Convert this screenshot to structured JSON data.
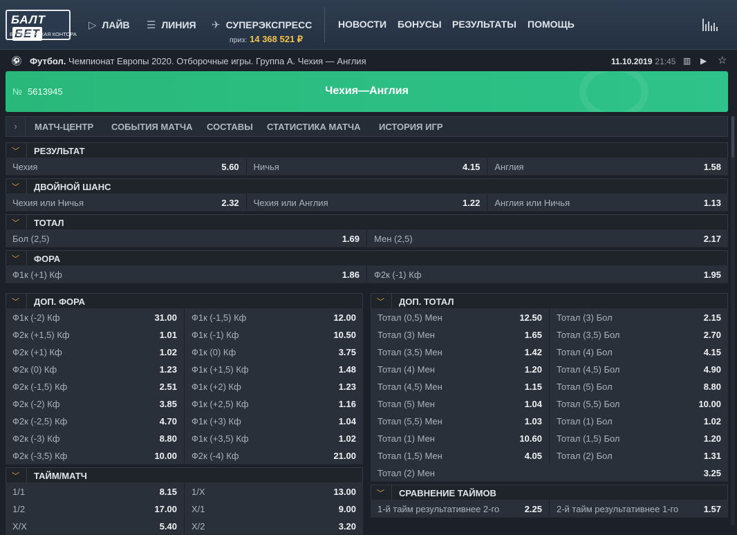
{
  "header": {
    "logo_main": "БАЛТ",
    "logo_box": "БЕТ",
    "logo_sub": "БУКМЕКЕРСКАЯ КОНТОРА",
    "nav": [
      {
        "label": "ЛАЙВ",
        "icon": "play-circle-icon"
      },
      {
        "label": "ЛИНИЯ",
        "icon": "list-icon"
      },
      {
        "label": "СУПЕРЭКСПРЕСС",
        "icon": "rocket-icon"
      },
      {
        "label": "НОВОСТИ"
      },
      {
        "label": "БОНУСЫ"
      },
      {
        "label": "РЕЗУЛЬТАТЫ"
      },
      {
        "label": "ПОМОЩЬ"
      }
    ],
    "prize_label": "приз:",
    "prize_value": "14 368 521 ₽",
    "stats_icon": "stats-icon"
  },
  "breadcrumb": {
    "sport": "Футбол.",
    "path": " Чемпионат Европы 2020. Отборочные игры. Группа А.  Чехия — Англия",
    "date": "11.10.2019",
    "time": "21:45"
  },
  "event": {
    "number_sign": "№",
    "number": "5613945",
    "title": "Чехия—Англия"
  },
  "tabs": [
    "МАТЧ-ЦЕНТР",
    "СОБЫТИЯ МАТЧА",
    "СОСТАВЫ",
    "СТАТИСТИКА МАТЧА",
    "ИСТОРИЯ ИГР"
  ],
  "markets": {
    "result": {
      "title": "РЕЗУЛЬТАТ",
      "rows": [
        [
          [
            "Чехия",
            "5.60"
          ],
          [
            "Ничья",
            "4.15"
          ],
          [
            "Англия",
            "1.58"
          ]
        ]
      ]
    },
    "double": {
      "title": "ДВОЙНОЙ ШАНС",
      "rows": [
        [
          [
            "Чехия или Ничья",
            "2.32"
          ],
          [
            "Чехия или Англия",
            "1.22"
          ],
          [
            "Англия или Ничья",
            "1.13"
          ]
        ]
      ]
    },
    "total": {
      "title": "ТОТАЛ",
      "rows": [
        [
          [
            "Бол (2,5)",
            "1.69"
          ],
          [
            "Мен (2,5)",
            "2.17"
          ]
        ]
      ]
    },
    "fora": {
      "title": "ФОРА",
      "rows": [
        [
          [
            "Ф1к (+1) Кф",
            "1.86"
          ],
          [
            "Ф2к (-1) Кф",
            "1.95"
          ]
        ]
      ]
    },
    "dop_fora": {
      "title": "ДОП. ФОРА",
      "rows": [
        [
          [
            "Ф1к (-2) Кф",
            "31.00"
          ],
          [
            "Ф1к (-1,5) Кф",
            "12.00"
          ]
        ],
        [
          [
            "Ф2к (+1,5) Кф",
            "1.01"
          ],
          [
            "Ф1к (-1) Кф",
            "10.50"
          ]
        ],
        [
          [
            "Ф2к (+1) Кф",
            "1.02"
          ],
          [
            "Ф1к (0) Кф",
            "3.75"
          ]
        ],
        [
          [
            "Ф2к (0) Кф",
            "1.23"
          ],
          [
            "Ф1к (+1,5) Кф",
            "1.48"
          ]
        ],
        [
          [
            "Ф2к (-1,5) Кф",
            "2.51"
          ],
          [
            "Ф1к (+2) Кф",
            "1.23"
          ]
        ],
        [
          [
            "Ф2к (-2) Кф",
            "3.85"
          ],
          [
            "Ф1к (+2,5) Кф",
            "1.16"
          ]
        ],
        [
          [
            "Ф2к (-2,5) Кф",
            "4.70"
          ],
          [
            "Ф1к (+3) Кф",
            "1.04"
          ]
        ],
        [
          [
            "Ф2к (-3) Кф",
            "8.80"
          ],
          [
            "Ф1к (+3,5) Кф",
            "1.02"
          ]
        ],
        [
          [
            "Ф2к (-3,5) Кф",
            "10.00"
          ],
          [
            "Ф2к (-4) Кф",
            "21.00"
          ]
        ]
      ]
    },
    "dop_total": {
      "title": "ДОП. ТОТАЛ",
      "rows": [
        [
          [
            "Тotal (0,5) Мен",
            "12.50"
          ],
          [
            "Тotal (3) Бол",
            "2.15"
          ]
        ],
        [
          [
            "Тotal (3) Мен",
            "1.65"
          ],
          [
            "Тotal (3,5) Бол",
            "2.70"
          ]
        ],
        [
          [
            "Тotal (3,5) Мен",
            "1.42"
          ],
          [
            "Тotal (4) Бол",
            "4.15"
          ]
        ],
        [
          [
            "Тotal (4) Мен",
            "1.20"
          ],
          [
            "Тotal (4,5) Бол",
            "4.90"
          ]
        ],
        [
          [
            "Тotal (4,5) Мен",
            "1.15"
          ],
          [
            "Тotal (5) Бол",
            "8.80"
          ]
        ],
        [
          [
            "Тotal (5) Мен",
            "1.04"
          ],
          [
            "Тotal (5,5) Бол",
            "10.00"
          ]
        ],
        [
          [
            "Тotal (5,5) Мен",
            "1.03"
          ],
          [
            "Тotal (1) Бол",
            "1.02"
          ]
        ],
        [
          [
            "Тotal (1) Мен",
            "10.60"
          ],
          [
            "Тotal (1,5) Бол",
            "1.20"
          ]
        ],
        [
          [
            "Тotal (1,5) Мен",
            "4.05"
          ],
          [
            "Тotal (2) Бол",
            "1.31"
          ]
        ],
        [
          [
            "Тotal (2) Мен",
            "3.25"
          ]
        ]
      ]
    },
    "taim_match": {
      "title": "ТАЙМ/МАТЧ",
      "rows": [
        [
          [
            "1/1",
            "8.15"
          ],
          [
            "1/X",
            "13.00"
          ]
        ],
        [
          [
            "1/2",
            "17.00"
          ],
          [
            "X/1",
            "9.00"
          ]
        ],
        [
          [
            "X/X",
            "5.40"
          ],
          [
            "X/2",
            "3.20"
          ]
        ]
      ]
    },
    "compare": {
      "title": "СРАВНЕНИЕ ТАЙМОВ",
      "rows": [
        [
          [
            "1-й тайм результативнее 2-го",
            "2.25"
          ],
          [
            "2-й тайм результативнее 1-го",
            "1.57"
          ]
        ]
      ]
    }
  }
}
